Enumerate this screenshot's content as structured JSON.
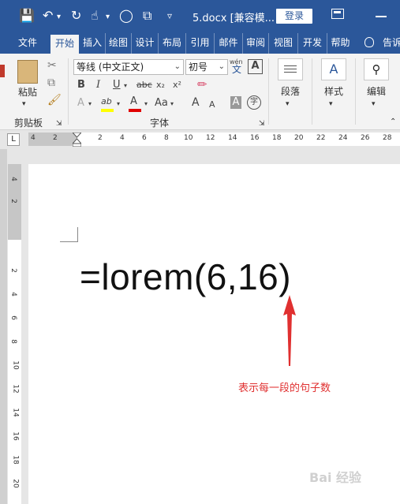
{
  "titlebar": {
    "doc_title": "5.docx [兼容模...",
    "login_label": "登录"
  },
  "tabs": [
    {
      "label": "文件"
    },
    {
      "label": "开始"
    },
    {
      "label": "插入"
    },
    {
      "label": "绘图"
    },
    {
      "label": "设计"
    },
    {
      "label": "布局"
    },
    {
      "label": "引用"
    },
    {
      "label": "邮件"
    },
    {
      "label": "审阅"
    },
    {
      "label": "视图"
    },
    {
      "label": "开发"
    },
    {
      "label": "帮助"
    },
    {
      "label": "告诉"
    }
  ],
  "ribbon": {
    "paste_label": "粘贴",
    "clipboard_label": "剪贴板",
    "font_name": "等线 (中文正文)",
    "font_size": "初号",
    "wen_label": "wén",
    "wen_char": "文",
    "a_box": "A",
    "font_group_label": "字体",
    "bold": "B",
    "italic": "I",
    "underline": "U",
    "strike": "abc",
    "subscript": "x₂",
    "superscript": "x²",
    "text_effect": "A",
    "highlight": "ab",
    "font_color": "A",
    "change_case": "Aa",
    "grow_font": "A",
    "shrink_font": "A",
    "char_shading": "A",
    "enclose": "字",
    "paragraph_label": "段落",
    "styles_label": "样式",
    "editing_label": "编辑"
  },
  "ruler": {
    "corner": "L",
    "h_numbers": [
      "4",
      "2",
      "2",
      "4",
      "6",
      "8",
      "10",
      "12",
      "14",
      "16",
      "18",
      "20",
      "22",
      "24",
      "26",
      "28"
    ],
    "v_numbers": [
      "4",
      "2",
      "2",
      "4",
      "6",
      "8",
      "10",
      "12",
      "14",
      "16",
      "18",
      "20"
    ]
  },
  "document": {
    "text": "=lorem(6,16)"
  },
  "annotation": {
    "text": "表示每一段的句子数",
    "color": "#e03030"
  },
  "watermark": {
    "text": "Bai 经验"
  },
  "colors": {
    "word_blue": "#2b579a",
    "highlight_yellow": "#ffff00",
    "font_red": "#e00000"
  }
}
